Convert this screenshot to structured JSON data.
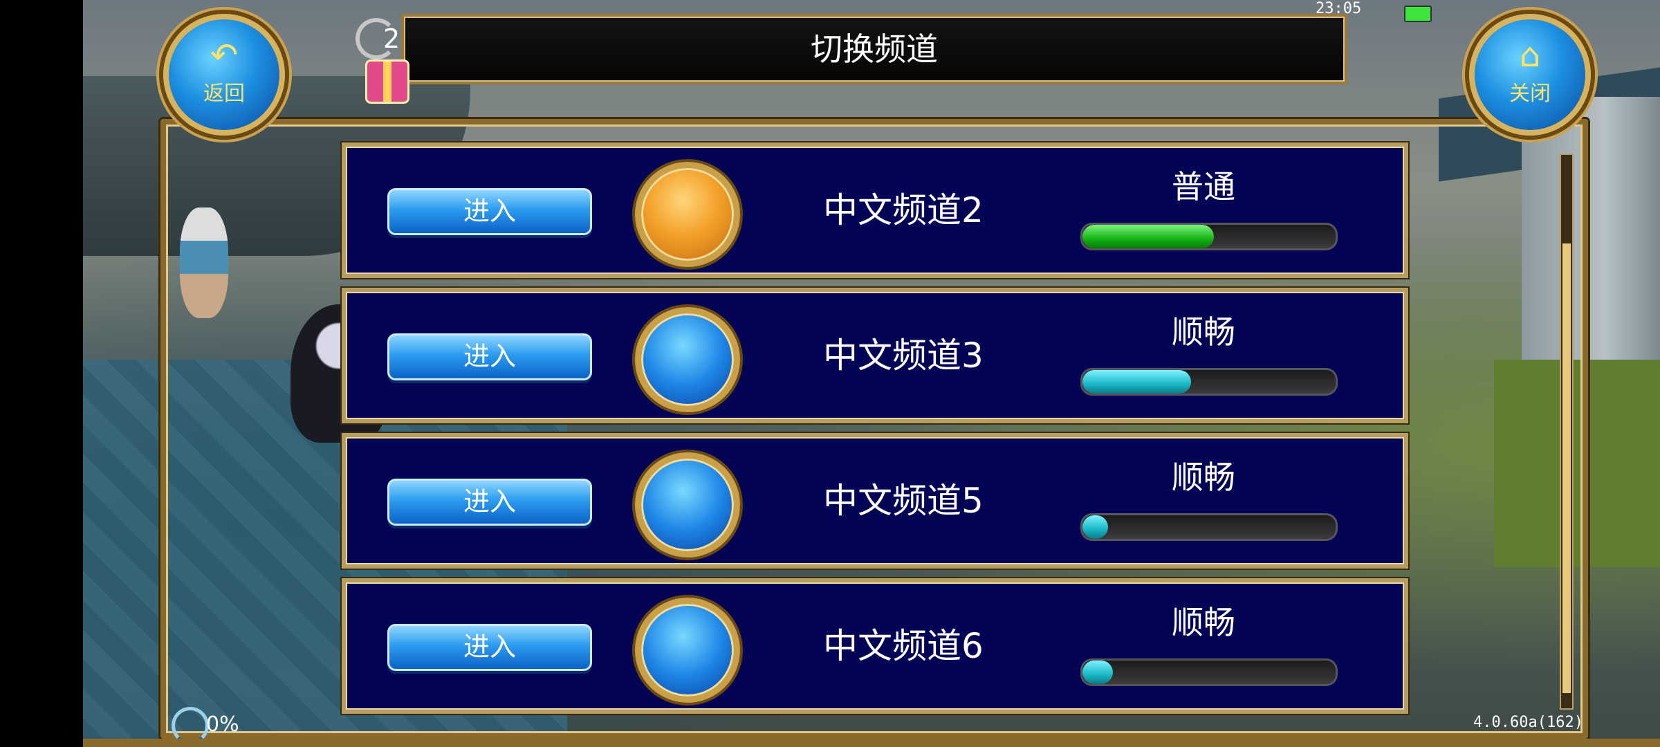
{
  "header": {
    "title": "切换频道",
    "back_button": {
      "icon": "arrow-back-icon",
      "label": "返回"
    },
    "close_button": {
      "icon": "home-icon",
      "label": "关闭"
    },
    "gift_count": "2",
    "clock": "23:05"
  },
  "channels": [
    {
      "enter_label": "进入",
      "name": "中文频道2",
      "quality": "普通",
      "status_color": "orange",
      "load": 0.52,
      "bar_color": "#14b414"
    },
    {
      "enter_label": "进入",
      "name": "中文频道3",
      "quality": "顺畅",
      "status_color": "blue",
      "load": 0.43,
      "bar_color": "#19b7c6"
    },
    {
      "enter_label": "进入",
      "name": "中文频道5",
      "quality": "顺畅",
      "status_color": "blue",
      "load": 0.1,
      "bar_color": "#19b7c6"
    },
    {
      "enter_label": "进入",
      "name": "中文频道6",
      "quality": "顺畅",
      "status_color": "blue",
      "load": 0.12,
      "bar_color": "#19b7c6"
    }
  ],
  "footer": {
    "percent": "0%",
    "version": "4.0.60a(162)"
  }
}
